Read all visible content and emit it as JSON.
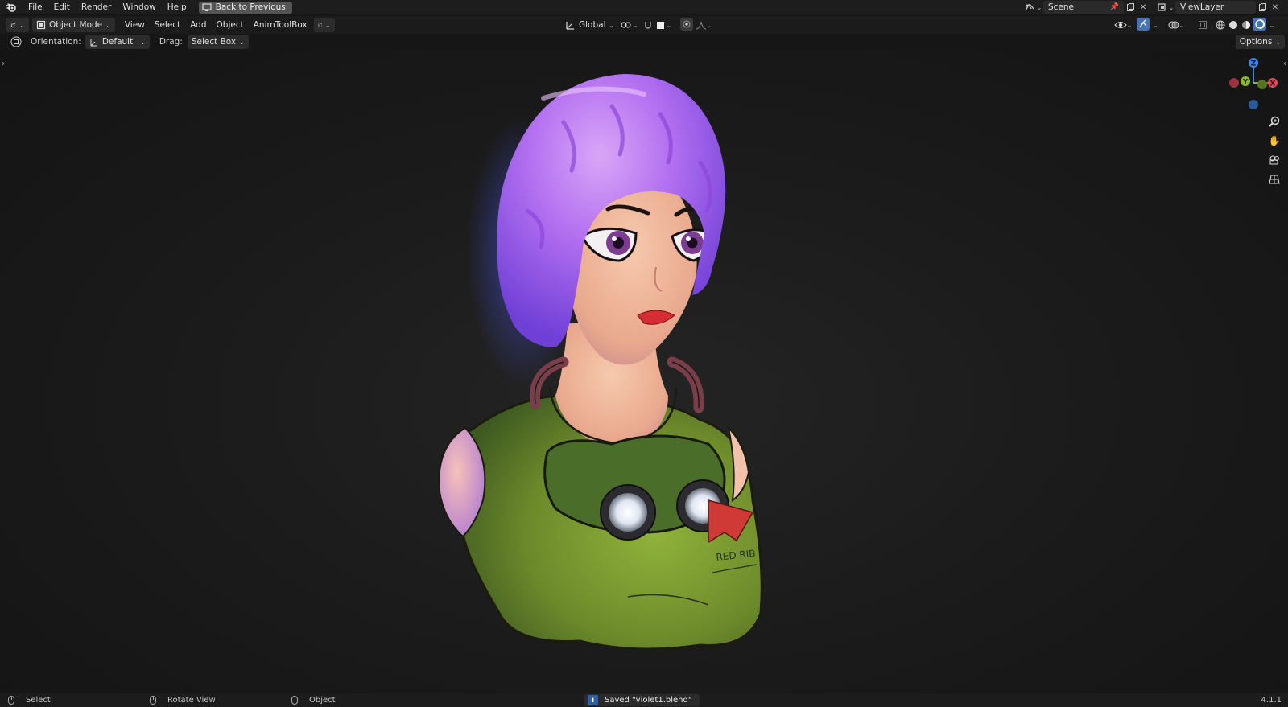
{
  "menubar": {
    "items": [
      "File",
      "Edit",
      "Render",
      "Window",
      "Help"
    ],
    "back_button": "Back to Previous",
    "scene_name": "Scene",
    "view_layer_name": "ViewLayer"
  },
  "header": {
    "mode": "Object Mode",
    "menus": [
      "View",
      "Select",
      "Add",
      "Object",
      "AnimToolBox"
    ],
    "transform_orientation": "Global"
  },
  "tool_settings": {
    "orientation_label": "Orientation:",
    "orientation_value": "Default",
    "drag_label": "Drag:",
    "drag_value": "Select Box",
    "options_label": "Options"
  },
  "gizmo": {
    "axis_x": "X",
    "axis_y": "Y",
    "axis_z": "Z"
  },
  "statusbar": {
    "select": "Select",
    "rotate_view": "Rotate View",
    "object": "Object",
    "saved_message": "Saved \"violet1.blend\"",
    "version": "4.1.1"
  },
  "model": {
    "shirt_text": "RED RIB"
  },
  "colors": {
    "accent": "#4772b3",
    "hair": "#a35ae0",
    "shirt": "#6f8a2c",
    "skin": "#f0b89c",
    "x_axis": "#e04a5a",
    "y_axis": "#8ab833",
    "z_axis": "#3d86e0"
  }
}
